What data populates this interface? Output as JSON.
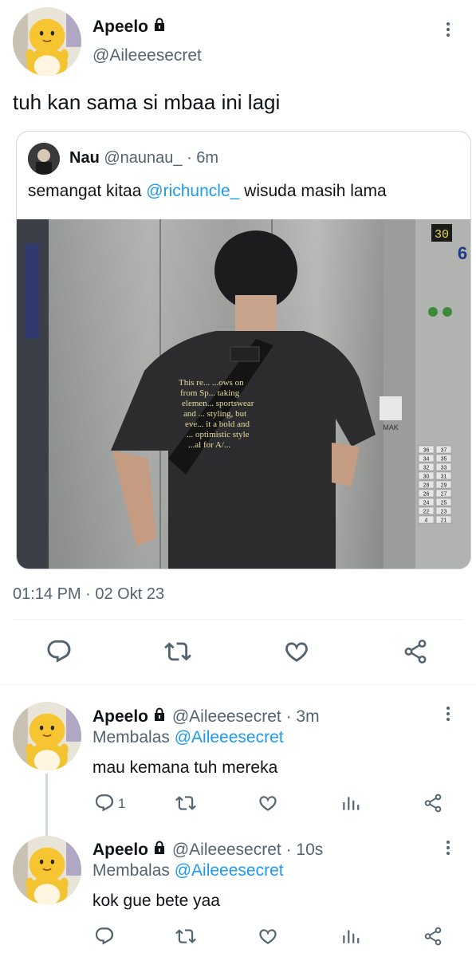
{
  "main_tweet": {
    "display_name": "Apeelo",
    "handle": "@Aileeesecret",
    "text": "tuh kan sama si mbaa ini lagi",
    "timestamp": "01:14 PM · 02 Okt 23"
  },
  "quoted_tweet": {
    "display_name": "Nau",
    "handle": "@naunau_",
    "time": "· 6m",
    "text_before": "semangat kitaa ",
    "mention": "@richuncle_",
    "text_after": " wisuda masih lama",
    "photo_shirt_text": [
      "This re... ...ows on",
      "from Sp... taking",
      "elemen... sportswear",
      "and ... styling, but",
      "eve... it a bold and",
      "... optimistic style",
      "...al for A/..."
    ],
    "elevator_display": "30",
    "elevator_floor": "6",
    "elevator_panel_label": "MAK",
    "elevator_buttons": [
      "36",
      "37",
      "34",
      "35",
      "32",
      "33",
      "30",
      "31",
      "28",
      "29",
      "26",
      "27",
      "24",
      "25",
      "22",
      "23",
      "4",
      "21"
    ]
  },
  "action_bar": {
    "reply": "reply-icon",
    "retweet": "retweet-icon",
    "like": "heart-icon",
    "share": "share-icon"
  },
  "replies": [
    {
      "display_name": "Apeelo",
      "handle": "@Aileeesecret",
      "time": "· 3m",
      "replying_prefix": "Membalas ",
      "replying_to": "@Aileeesecret",
      "text": "mau kemana tuh mereka",
      "reply_count": "1"
    },
    {
      "display_name": "Apeelo",
      "handle": "@Aileeesecret",
      "time": "· 10s",
      "replying_prefix": "Membalas ",
      "replying_to": "@Aileeesecret",
      "text": "kok gue bete yaa",
      "reply_count": ""
    }
  ],
  "colors": {
    "accent": "#1d9bf0",
    "secondary_text": "#536471",
    "divider": "#eff3f4"
  }
}
